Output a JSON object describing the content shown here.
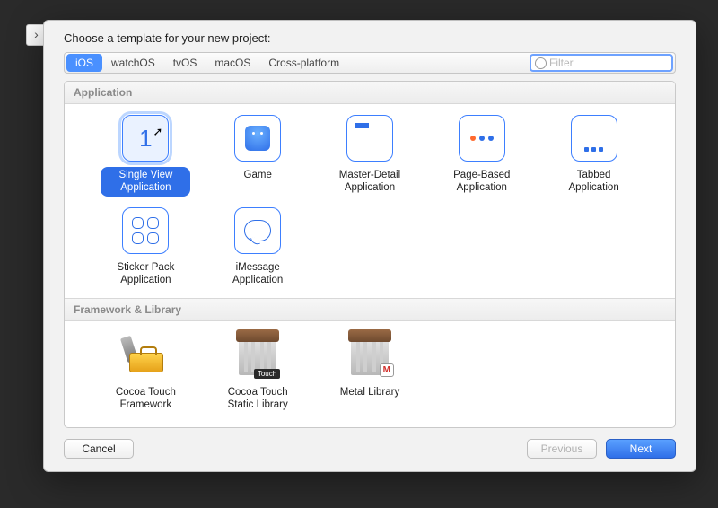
{
  "prompt": "Choose a template for your new project:",
  "tabs": {
    "items": [
      "iOS",
      "watchOS",
      "tvOS",
      "macOS",
      "Cross-platform"
    ],
    "active": "iOS"
  },
  "filter": {
    "placeholder": "Filter"
  },
  "sections": {
    "application": {
      "title": "Application"
    },
    "framework": {
      "title": "Framework & Library"
    }
  },
  "templates": {
    "single_view": {
      "label": "Single View Application",
      "num": "1"
    },
    "game": {
      "label": "Game"
    },
    "master_detail": {
      "label": "Master-Detail Application"
    },
    "page_based": {
      "label": "Page-Based Application"
    },
    "tabbed": {
      "label": "Tabbed Application"
    },
    "sticker": {
      "label": "Sticker Pack Application"
    },
    "imessage": {
      "label": "iMessage Application"
    },
    "cocoa_fw": {
      "label": "Cocoa Touch Framework"
    },
    "cocoa_lib": {
      "label": "Cocoa Touch Static Library",
      "badge": "Touch"
    },
    "metal": {
      "label": "Metal Library",
      "badge": "M"
    }
  },
  "footer": {
    "cancel": "Cancel",
    "previous": "Previous",
    "next": "Next"
  }
}
